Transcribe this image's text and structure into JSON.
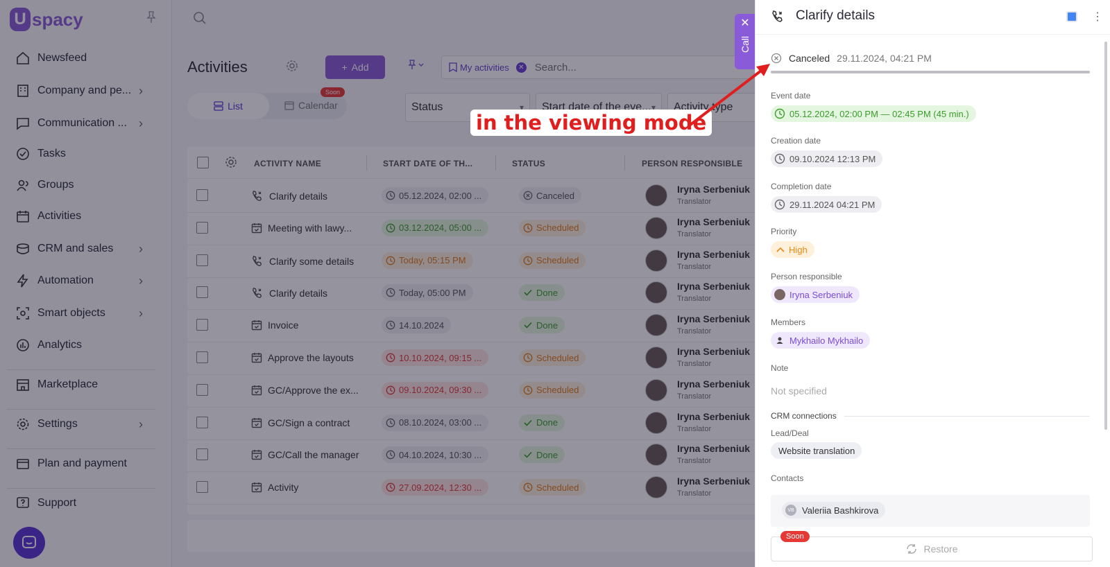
{
  "app": {
    "brand_u": "U",
    "brand_name": "spacy"
  },
  "sidebar": {
    "items": [
      {
        "label": "Newsfeed",
        "icon": "home-icon"
      },
      {
        "label": "Company and pe...",
        "icon": "building-icon",
        "chevron": true
      },
      {
        "label": "Communication ...",
        "icon": "chat-icon",
        "chevron": true
      },
      {
        "label": "Tasks",
        "icon": "check-circle-icon"
      },
      {
        "label": "Groups",
        "icon": "users-icon"
      },
      {
        "label": "Activities",
        "icon": "calendar-icon"
      },
      {
        "label": "CRM and sales",
        "icon": "crm-icon",
        "chevron": true
      },
      {
        "label": "Automation",
        "icon": "bolt-icon",
        "chevron": true
      },
      {
        "label": "Smart objects",
        "icon": "smart-icon",
        "chevron": true
      },
      {
        "label": "Analytics",
        "icon": "chart-icon"
      },
      {
        "label": "Marketplace",
        "icon": "store-icon"
      },
      {
        "label": "Settings",
        "icon": "gear-icon",
        "chevron": true
      },
      {
        "label": "Plan and payment",
        "icon": "card-icon"
      },
      {
        "label": "Support",
        "icon": "help-icon"
      }
    ]
  },
  "page": {
    "title": "Activities",
    "add_label": "Add",
    "filter_chip": "My activities",
    "search_placeholder": "Search...",
    "tab_list": "List",
    "tab_calendar": "Calendar",
    "soon": "Soon",
    "filters": [
      "Status",
      "Start date of the eve...",
      "Activity type"
    ]
  },
  "table": {
    "headers": [
      "ACTIVITY NAME",
      "START DATE OF TH...",
      "STATUS",
      "PERSON RESPONSIBLE"
    ],
    "rows": [
      {
        "name": "Clarify details",
        "type": "call",
        "date": "05.12.2024, 02:00 ...",
        "date_tone": "gray",
        "status": "Canceled",
        "status_tone": "gray",
        "person": "Iryna Serbeniuk",
        "role": "Translator"
      },
      {
        "name": "Meeting with lawy...",
        "type": "meeting",
        "date": "03.12.2024, 05:00 ...",
        "date_tone": "green",
        "status": "Scheduled",
        "status_tone": "orange",
        "person": "Iryna Serbeniuk",
        "role": "Translator"
      },
      {
        "name": "Clarify some details",
        "type": "call",
        "date": "Today, 05:15 PM",
        "date_tone": "orange",
        "status": "Scheduled",
        "status_tone": "orange",
        "person": "Iryna Serbeniuk",
        "role": "Translator"
      },
      {
        "name": "Clarify details",
        "type": "call",
        "date": "Today, 05:00 PM",
        "date_tone": "gray",
        "status": "Done",
        "status_tone": "green",
        "person": "Iryna Serbeniuk",
        "role": "Translator"
      },
      {
        "name": "Invoice",
        "type": "meeting",
        "date": "14.10.2024",
        "date_tone": "gray",
        "status": "Done",
        "status_tone": "green",
        "person": "Iryna Serbeniuk",
        "role": "Translator"
      },
      {
        "name": "Approve the layouts",
        "type": "meeting",
        "date": "10.10.2024, 09:15 ...",
        "date_tone": "red",
        "status": "Scheduled",
        "status_tone": "orange",
        "person": "Iryna Serbeniuk",
        "role": "Translator"
      },
      {
        "name": "GC/Approve the ex...",
        "type": "meeting",
        "date": "09.10.2024, 09:30 ...",
        "date_tone": "red",
        "status": "Scheduled",
        "status_tone": "orange",
        "person": "Iryna Serbeniuk",
        "role": "Translator"
      },
      {
        "name": "GC/Sign a contract",
        "type": "meeting",
        "date": "08.10.2024, 03:00 ...",
        "date_tone": "gray",
        "status": "Done",
        "status_tone": "green",
        "person": "Iryna Serbeniuk",
        "role": "Translator"
      },
      {
        "name": "GC/Call the manager",
        "type": "meeting",
        "date": "04.10.2024, 10:30 ...",
        "date_tone": "gray",
        "status": "Done",
        "status_tone": "green",
        "person": "Iryna Serbeniuk",
        "role": "Translator"
      },
      {
        "name": "Activity",
        "type": "meeting",
        "date": "27.09.2024, 12:30 ...",
        "date_tone": "red",
        "status": "Scheduled",
        "status_tone": "orange",
        "person": "Iryna Serbeniuk",
        "role": "Translator"
      }
    ]
  },
  "call_tab": {
    "label": "Call",
    "close": "✕"
  },
  "panel": {
    "title": "Clarify details",
    "status": "Canceled",
    "status_time": "29.11.2024, 04:21 PM",
    "event_date_label": "Event date",
    "event_date": "05.12.2024, 02:00 PM — 02:45 PM (45 min.)",
    "creation_label": "Creation date",
    "creation": "09.10.2024 12:13 PM",
    "completion_label": "Completion date",
    "completion": "29.11.2024 04:21 PM",
    "priority_label": "Priority",
    "priority": "High",
    "person_label": "Person responsible",
    "person": "Iryna Serbeniuk",
    "members_label": "Members",
    "member": "Mykhailo Mykhailo",
    "note_label": "Note",
    "note": "Not specified",
    "crm_label": "CRM connections",
    "lead_label": "Lead/Deal",
    "lead": "Website translation",
    "contacts_label": "Contacts",
    "contact": "Valeriia Bashkirova",
    "contact_initials": "VB",
    "soon": "Soon",
    "restore": "Restore"
  },
  "annotation": {
    "text": "in the viewing mode",
    "color": "#e01e1e"
  },
  "colors": {
    "accent": "#8a5bd8",
    "overlay": "rgba(20,18,40,.45)"
  }
}
